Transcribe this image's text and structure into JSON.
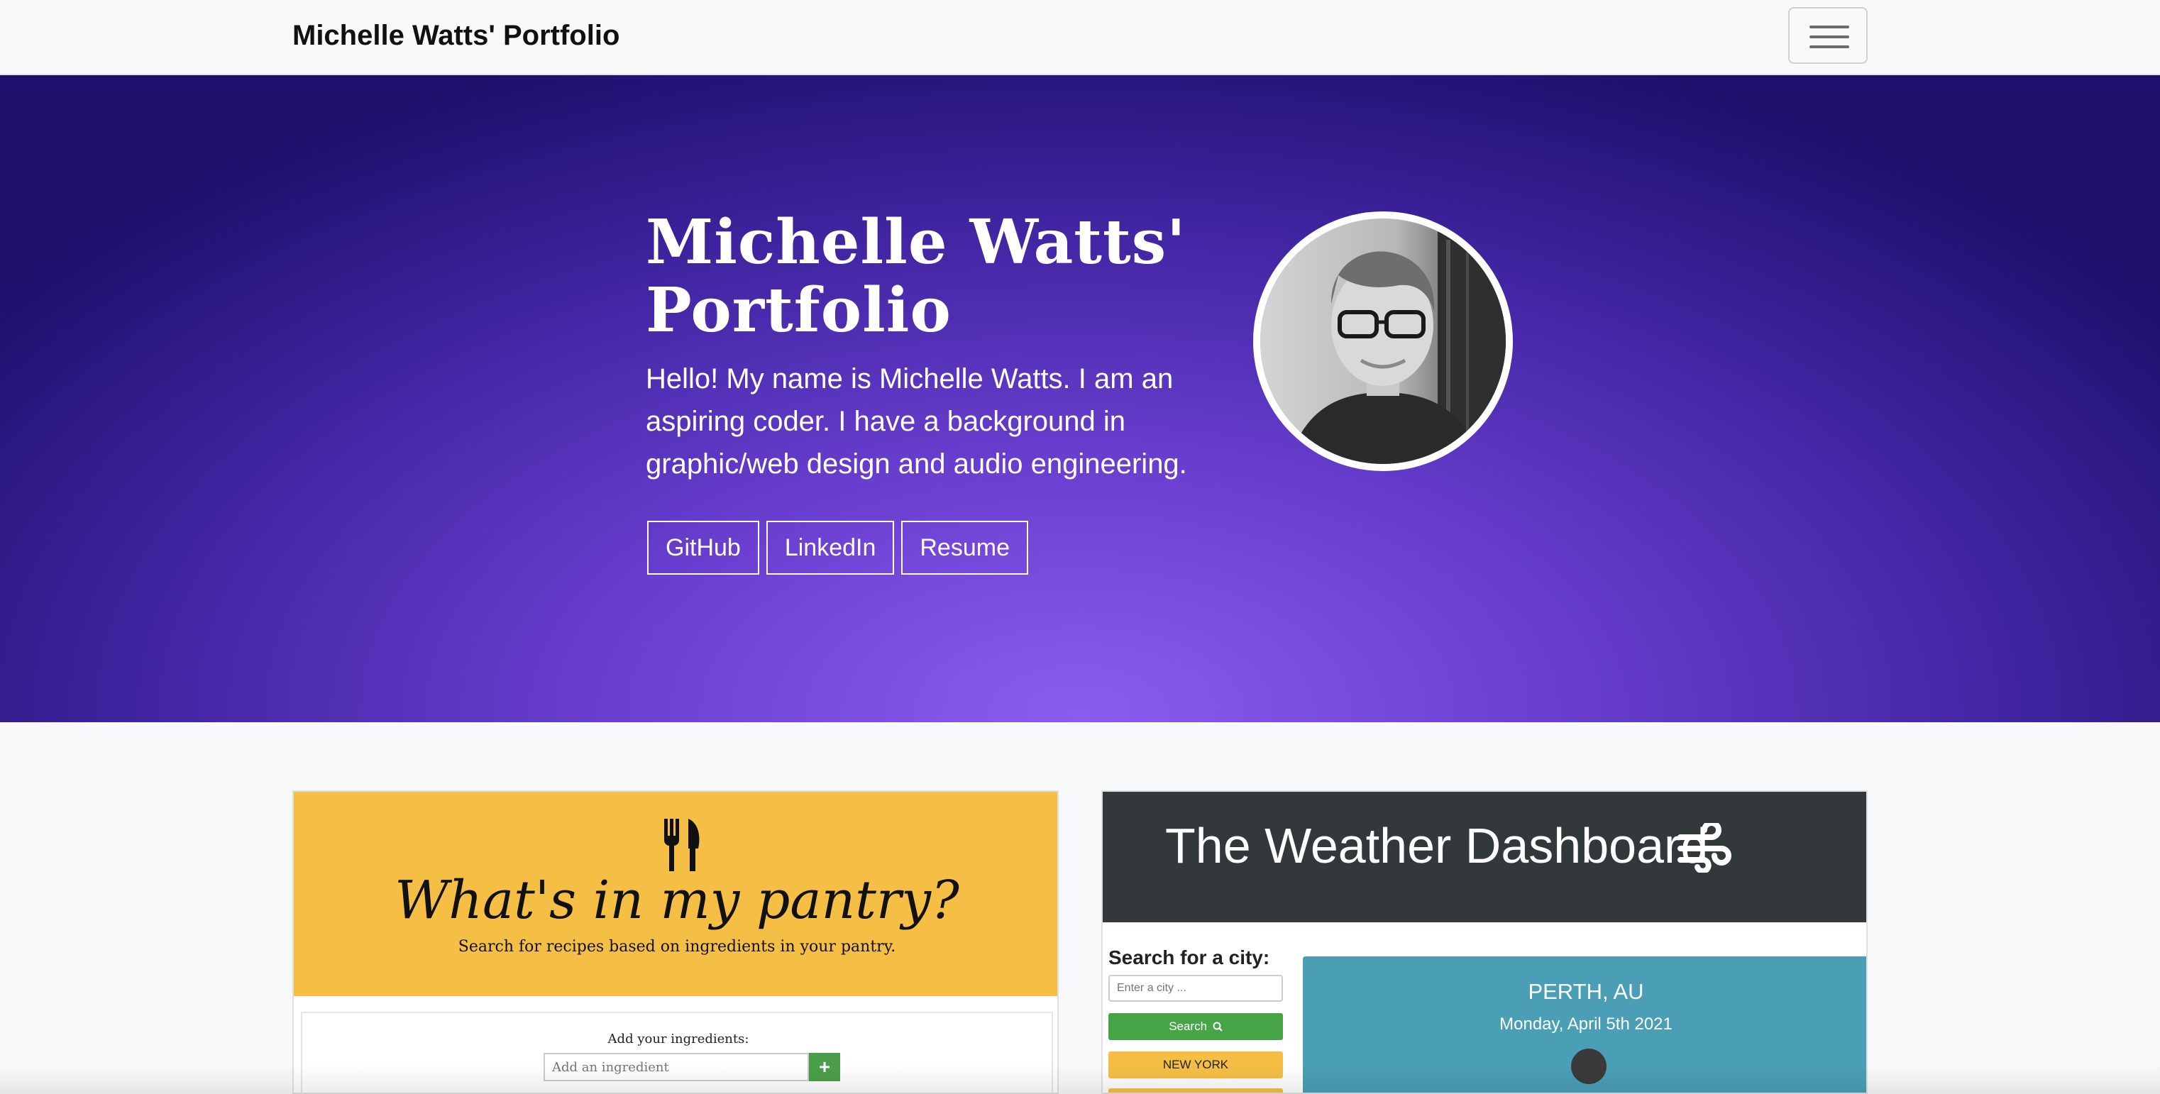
{
  "navbar": {
    "brand": "Michelle Watts' Portfolio",
    "toggle_icon": "hamburger-menu-icon"
  },
  "hero": {
    "title": "Michelle Watts' Portfolio",
    "intro": "Hello! My name is Michelle Watts. I am an aspiring coder. I have a background in graphic/web design and audio engineering.",
    "buttons": [
      "GitHub",
      "LinkedIn",
      "Resume"
    ],
    "avatar": "profile-photo"
  },
  "projects": [
    {
      "name": "pantry",
      "icon": "fork-knife-icon",
      "title": "What's in my pantry?",
      "subtitle": "Search for recipes based on ingredients in your pantry.",
      "add_label": "Add your ingredients:",
      "input_placeholder": "Add an ingredient",
      "add_button": "+",
      "accent": "#f5bf45"
    },
    {
      "name": "weather",
      "title": "The Weather Dashboard",
      "icon": "wind-icon",
      "search_label": "Search for a city:",
      "input_placeholder": "Enter a city ...",
      "search_button": "Search",
      "search_icon": "search-icon",
      "city_buttons": [
        "NEW YORK"
      ],
      "current_city": "PERTH, AU",
      "current_date": "Monday, April 5th 2021",
      "header_color": "#33383b",
      "panel_color": "#4a9fb6"
    }
  ],
  "colors": {
    "hero_dark": "#1d0f6a",
    "hero_light": "#8b5cf0",
    "navbar_bg": "#f8f9fa"
  }
}
